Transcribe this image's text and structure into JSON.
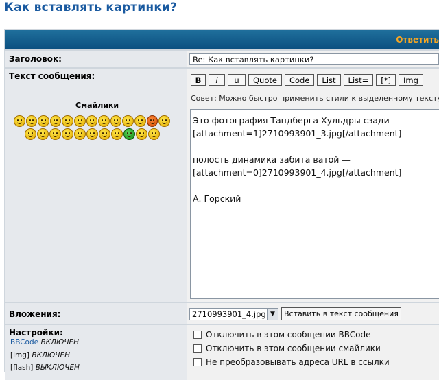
{
  "page": {
    "title": "Как вставлять картинки?"
  },
  "header": {
    "reply_label": "Ответить"
  },
  "subject": {
    "label": "Заголовок:",
    "value": "Re: Как вставлять картинки?"
  },
  "message": {
    "label": "Текст сообщения:",
    "smilies_title": "Смайлики",
    "toolbar": [
      "B",
      "i",
      "u",
      "Quote",
      "Code",
      "List",
      "List=",
      "[*]",
      "Img"
    ],
    "hint": "Совет: Можно быстро применить стили к выделенному тексту.",
    "body": "Это фотография Тандберга Хульдры сзади —\n[attachment=1]2710993901_3.jpg[/attachment]\n\nполость динамика забита ватой —\n[attachment=0]2710993901_4.jpg[/attachment]\n\nА. Горский"
  },
  "attachments": {
    "label": "Вложения:",
    "selected": "2710993901_4.jpg",
    "insert_button": "Вставить в текст сообщения"
  },
  "settings": {
    "label": "Настройки:",
    "items": [
      {
        "link": "BBCode",
        "state": "ВКЛЮЧЕН"
      },
      {
        "link": "[img]",
        "state": "ВКЛЮЧЕН"
      },
      {
        "link": "[flash]",
        "state": "ВЫКЛЮЧЕН"
      }
    ],
    "options": [
      "Отключить в этом сообщении BBCode",
      "Отключить в этом сообщении смайлики",
      "Не преобразовывать адреса URL в ссылки"
    ]
  },
  "colors": {
    "title": "#1a5aa0",
    "header": "#0b4f80",
    "reply": "#f5a623"
  }
}
